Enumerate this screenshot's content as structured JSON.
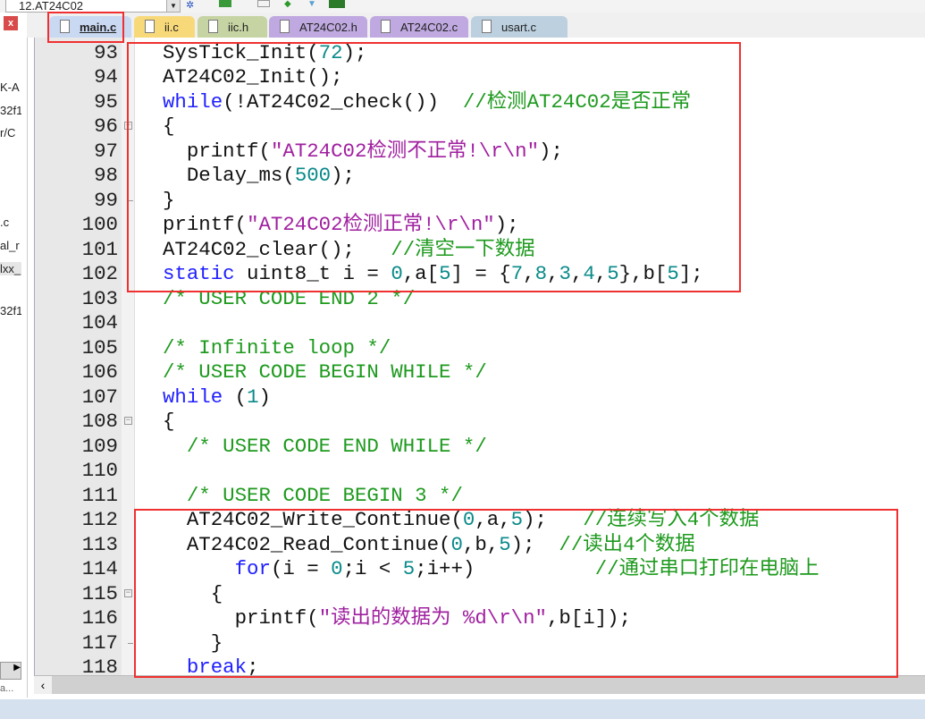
{
  "toolbar": {
    "target": "12.AT24C02"
  },
  "left_panel": {
    "fragments": [
      {
        "text": "K-A",
        "selected": false
      },
      {
        "text": "32f1",
        "selected": false
      },
      {
        "text": "r/C",
        "selected": false
      },
      {
        "text": ".c",
        "selected": false
      },
      {
        "text": "al_r",
        "selected": false
      },
      {
        "text": "lxx_",
        "selected": true
      },
      {
        "text": "32f1",
        "selected": false
      }
    ],
    "bottom": "a..."
  },
  "tabs": [
    {
      "label": "main.c",
      "color": "#c9d9f2",
      "active": true
    },
    {
      "label": "ii.c",
      "color": "#f8d97a",
      "active": false
    },
    {
      "label": "iic.h",
      "color": "#c6d3a3",
      "active": false
    },
    {
      "label": "AT24C02.h",
      "color": "#bfa9e0",
      "active": false
    },
    {
      "label": "AT24C02.c",
      "color": "#bfa9e0",
      "active": false
    },
    {
      "label": "usart.c",
      "color": "#bcd0df",
      "active": false
    }
  ],
  "colors": {
    "keyword": "#2020ff",
    "number": "#0a8a8a",
    "string": "#a020a0",
    "comment": "#1e9a1e",
    "highlight_box": "#f03030"
  },
  "code": [
    {
      "n": "93",
      "fold": "",
      "tokens": [
        [
          "plain",
          "SysTick_Init("
        ],
        [
          "num",
          "72"
        ],
        [
          "plain",
          ");"
        ]
      ]
    },
    {
      "n": "94",
      "fold": "",
      "tokens": [
        [
          "plain",
          "AT24C02_Init();"
        ]
      ]
    },
    {
      "n": "95",
      "fold": "",
      "tokens": [
        [
          "kw",
          "while"
        ],
        [
          "plain",
          "(!AT24C02_check())  "
        ],
        [
          "cmt",
          "//检测AT24C02是否正常"
        ]
      ]
    },
    {
      "n": "96",
      "fold": "open",
      "tokens": [
        [
          "plain",
          "{"
        ]
      ]
    },
    {
      "n": "97",
      "fold": "",
      "tokens": [
        [
          "plain",
          "  printf("
        ],
        [
          "str",
          "\"AT24C02检测不正常!\\r\\n\""
        ],
        [
          "plain",
          ");"
        ]
      ]
    },
    {
      "n": "98",
      "fold": "",
      "tokens": [
        [
          "plain",
          "  Delay_ms("
        ],
        [
          "num",
          "500"
        ],
        [
          "plain",
          ");"
        ]
      ]
    },
    {
      "n": "99",
      "fold": "end",
      "tokens": [
        [
          "plain",
          "}"
        ]
      ]
    },
    {
      "n": "100",
      "fold": "",
      "tokens": [
        [
          "plain",
          "printf("
        ],
        [
          "str",
          "\"AT24C02检测正常!\\r\\n\""
        ],
        [
          "plain",
          ");"
        ]
      ]
    },
    {
      "n": "101",
      "fold": "",
      "tokens": [
        [
          "plain",
          "AT24C02_clear();   "
        ],
        [
          "cmt",
          "//清空一下数据"
        ]
      ]
    },
    {
      "n": "102",
      "fold": "",
      "tokens": [
        [
          "kw",
          "static"
        ],
        [
          "plain",
          " uint8_t i = "
        ],
        [
          "num",
          "0"
        ],
        [
          "plain",
          ",a["
        ],
        [
          "num",
          "5"
        ],
        [
          "plain",
          "] = {"
        ],
        [
          "num",
          "7"
        ],
        [
          "plain",
          ","
        ],
        [
          "num",
          "8"
        ],
        [
          "plain",
          ","
        ],
        [
          "num",
          "3"
        ],
        [
          "plain",
          ","
        ],
        [
          "num",
          "4"
        ],
        [
          "plain",
          ","
        ],
        [
          "num",
          "5"
        ],
        [
          "plain",
          "},b["
        ],
        [
          "num",
          "5"
        ],
        [
          "plain",
          "];"
        ]
      ]
    },
    {
      "n": "103",
      "fold": "",
      "tokens": [
        [
          "cmt",
          "/* USER CODE END 2 */"
        ]
      ]
    },
    {
      "n": "104",
      "fold": "",
      "tokens": []
    },
    {
      "n": "105",
      "fold": "",
      "tokens": [
        [
          "cmt",
          "/* Infinite loop */"
        ]
      ]
    },
    {
      "n": "106",
      "fold": "",
      "tokens": [
        [
          "cmt",
          "/* USER CODE BEGIN WHILE */"
        ]
      ]
    },
    {
      "n": "107",
      "fold": "",
      "tokens": [
        [
          "kw",
          "while"
        ],
        [
          "plain",
          " ("
        ],
        [
          "num",
          "1"
        ],
        [
          "plain",
          ")"
        ]
      ]
    },
    {
      "n": "108",
      "fold": "open",
      "tokens": [
        [
          "plain",
          "{"
        ]
      ]
    },
    {
      "n": "109",
      "fold": "",
      "tokens": [
        [
          "plain",
          "  "
        ],
        [
          "cmt",
          "/* USER CODE END WHILE */"
        ]
      ]
    },
    {
      "n": "110",
      "fold": "",
      "tokens": []
    },
    {
      "n": "111",
      "fold": "",
      "tokens": [
        [
          "plain",
          "  "
        ],
        [
          "cmt",
          "/* USER CODE BEGIN 3 */"
        ]
      ]
    },
    {
      "n": "112",
      "fold": "",
      "tokens": [
        [
          "plain",
          "  AT24C02_Write_Continue("
        ],
        [
          "num",
          "0"
        ],
        [
          "plain",
          ",a,"
        ],
        [
          "num",
          "5"
        ],
        [
          "plain",
          ");   "
        ],
        [
          "cmt",
          "//连续写入4个数据"
        ]
      ]
    },
    {
      "n": "113",
      "fold": "",
      "tokens": [
        [
          "plain",
          "  AT24C02_Read_Continue("
        ],
        [
          "num",
          "0"
        ],
        [
          "plain",
          ",b,"
        ],
        [
          "num",
          "5"
        ],
        [
          "plain",
          ");  "
        ],
        [
          "cmt",
          "//读出4个数据"
        ]
      ]
    },
    {
      "n": "114",
      "fold": "",
      "tokens": [
        [
          "plain",
          "      "
        ],
        [
          "kw",
          "for"
        ],
        [
          "plain",
          "(i = "
        ],
        [
          "num",
          "0"
        ],
        [
          "plain",
          ";i < "
        ],
        [
          "num",
          "5"
        ],
        [
          "plain",
          ";i++)          "
        ],
        [
          "cmt",
          "//通过串口打印在电脑上"
        ]
      ]
    },
    {
      "n": "115",
      "fold": "open",
      "tokens": [
        [
          "plain",
          "    {"
        ]
      ]
    },
    {
      "n": "116",
      "fold": "",
      "tokens": [
        [
          "plain",
          "      printf("
        ],
        [
          "str",
          "\"读出的数据为 %d\\r\\n\""
        ],
        [
          "plain",
          ",b[i]);"
        ]
      ]
    },
    {
      "n": "117",
      "fold": "end",
      "tokens": [
        [
          "plain",
          "    }"
        ]
      ]
    },
    {
      "n": "118",
      "fold": "",
      "tokens": [
        [
          "plain",
          "  "
        ],
        [
          "kw",
          "break"
        ],
        [
          "plain",
          ";"
        ]
      ]
    }
  ]
}
